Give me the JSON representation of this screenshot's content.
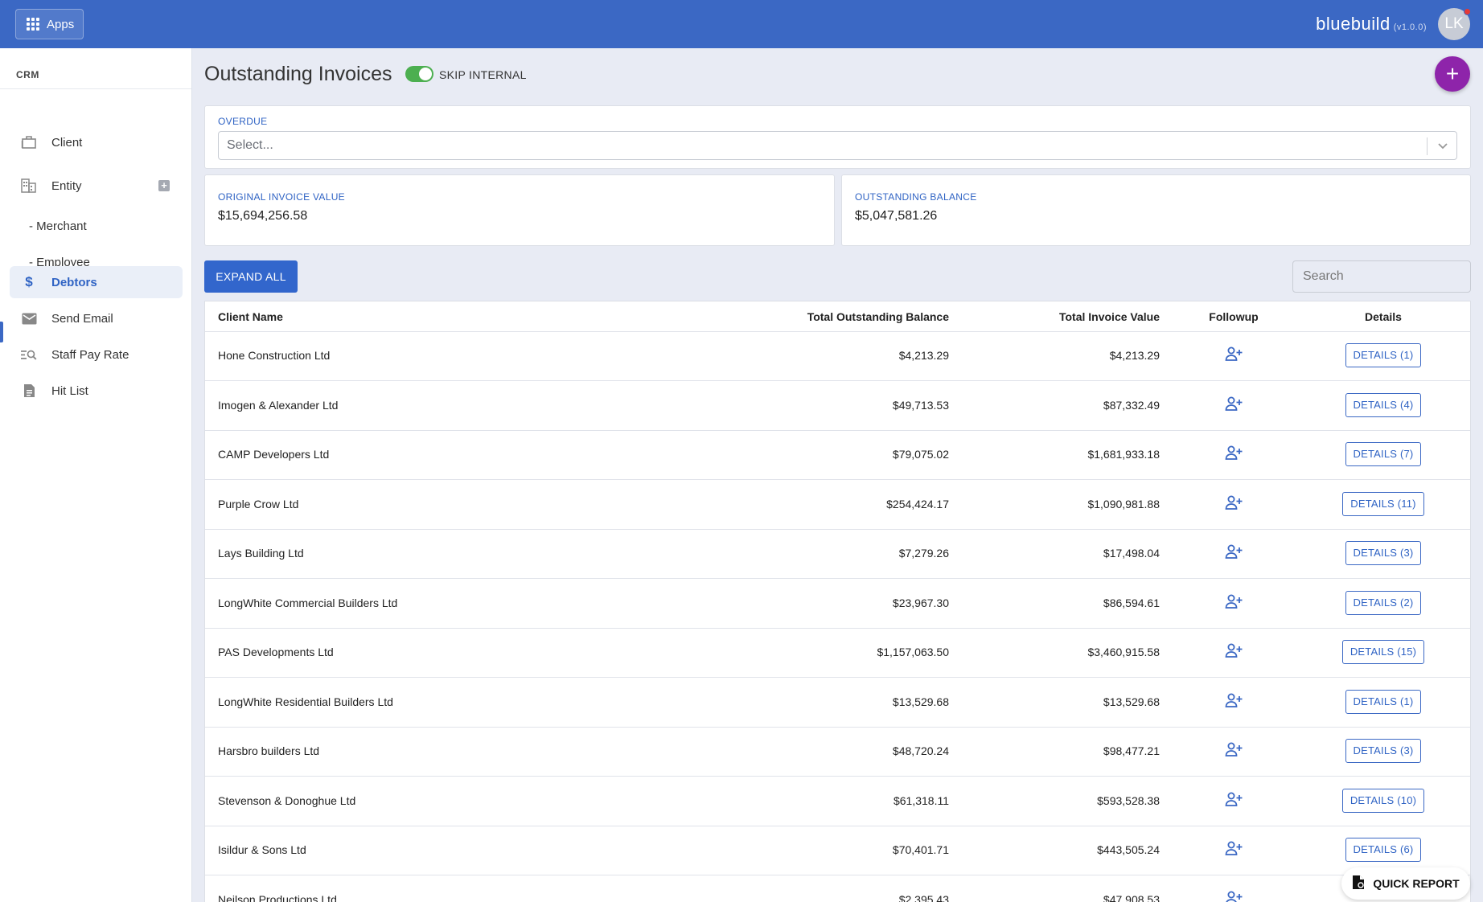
{
  "topbar": {
    "apps_label": "Apps",
    "brand": "bluebuild",
    "version": "(v1.0.0)",
    "avatar_initials": "LK"
  },
  "sidebar": {
    "heading": "CRM",
    "items": [
      {
        "label": "Client",
        "icon": "briefcase-icon"
      },
      {
        "label": "Entity",
        "icon": "building-icon"
      },
      {
        "label": "- Merchant",
        "icon": ""
      },
      {
        "label": "- Employee",
        "icon": ""
      },
      {
        "label": "Debtors",
        "icon": "dollar-icon",
        "active": true
      },
      {
        "label": "Send Email",
        "icon": "mail-icon"
      },
      {
        "label": "Staff Pay Rate",
        "icon": "search-list-icon"
      },
      {
        "label": "Hit List",
        "icon": "document-icon"
      }
    ]
  },
  "page": {
    "title": "Outstanding Invoices",
    "toggle_label": "SKIP INTERNAL",
    "toggle_on": true
  },
  "filter": {
    "label": "OVERDUE",
    "placeholder": "Select..."
  },
  "summary": {
    "original_label": "ORIGINAL INVOICE VALUE",
    "original_value": "$15,694,256.58",
    "outstanding_label": "OUTSTANDING BALANCE",
    "outstanding_value": "$5,047,581.26"
  },
  "toolbar": {
    "expand_label": "EXPAND ALL",
    "search_placeholder": "Search"
  },
  "table": {
    "columns": {
      "name": "Client Name",
      "outstanding": "Total Outstanding Balance",
      "invoice": "Total Invoice Value",
      "followup": "Followup",
      "details": "Details"
    },
    "rows": [
      {
        "name": "Hone Construction Ltd",
        "outstanding": "$4,213.29",
        "invoice": "$4,213.29",
        "details": "DETAILS (1)"
      },
      {
        "name": "Imogen & Alexander Ltd",
        "outstanding": "$49,713.53",
        "invoice": "$87,332.49",
        "details": "DETAILS (4)"
      },
      {
        "name": "CAMP Developers Ltd",
        "outstanding": "$79,075.02",
        "invoice": "$1,681,933.18",
        "details": "DETAILS (7)"
      },
      {
        "name": "Purple Crow Ltd",
        "outstanding": "$254,424.17",
        "invoice": "$1,090,981.88",
        "details": "DETAILS (11)"
      },
      {
        "name": "Lays Building Ltd",
        "outstanding": "$7,279.26",
        "invoice": "$17,498.04",
        "details": "DETAILS (3)"
      },
      {
        "name": "LongWhite Commercial Builders Ltd",
        "outstanding": "$23,967.30",
        "invoice": "$86,594.61",
        "details": "DETAILS (2)"
      },
      {
        "name": "PAS Developments Ltd",
        "outstanding": "$1,157,063.50",
        "invoice": "$3,460,915.58",
        "details": "DETAILS (15)"
      },
      {
        "name": "LongWhite Residential Builders Ltd",
        "outstanding": "$13,529.68",
        "invoice": "$13,529.68",
        "details": "DETAILS (1)"
      },
      {
        "name": "Harsbro builders Ltd",
        "outstanding": "$48,720.24",
        "invoice": "$98,477.21",
        "details": "DETAILS (3)"
      },
      {
        "name": "Stevenson & Donoghue Ltd",
        "outstanding": "$61,318.11",
        "invoice": "$593,528.38",
        "details": "DETAILS (10)"
      },
      {
        "name": "Isildur & Sons Ltd",
        "outstanding": "$70,401.71",
        "invoice": "$443,505.24",
        "details": "DETAILS (6)"
      },
      {
        "name": "Neilson Productions Ltd",
        "outstanding": "$2,395.43",
        "invoice": "$47,908.53",
        "details": ""
      }
    ]
  },
  "quick_report": {
    "label": "QUICK REPORT"
  },
  "colors": {
    "primary": "#3b68c4",
    "fab": "#8e24aa",
    "toggle": "#4caf50"
  }
}
